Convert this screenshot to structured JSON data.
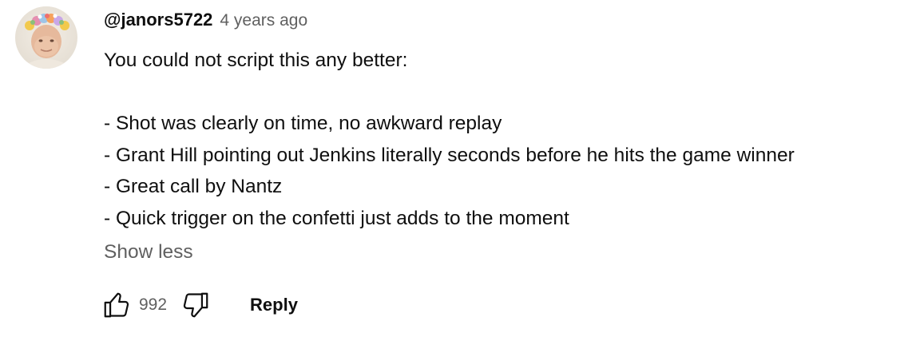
{
  "comment": {
    "author": "@janors5722",
    "timestamp": "4 years ago",
    "avatar_icon": "user-avatar-icon",
    "lines": [
      "You could not script this any better:",
      "",
      "- Shot was clearly on time, no awkward replay",
      "- Grant Hill pointing out Jenkins literally seconds before he hits the game winner",
      "- Great call by Nantz",
      "- Quick trigger on the confetti just adds to the moment"
    ],
    "show_less_label": "Show less"
  },
  "actions": {
    "like_icon": "thumbs-up-icon",
    "like_count": "992",
    "dislike_icon": "thumbs-down-icon",
    "reply_label": "Reply"
  },
  "colors": {
    "text_primary": "#0f0f0f",
    "text_secondary": "#606060",
    "background": "#ffffff"
  }
}
